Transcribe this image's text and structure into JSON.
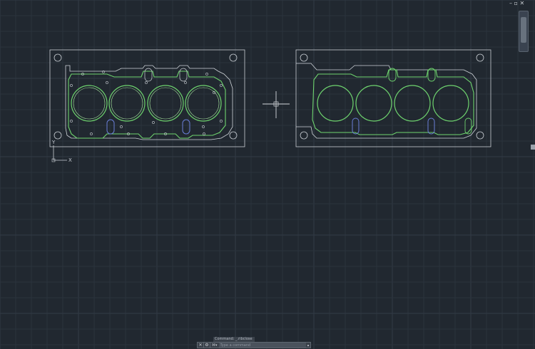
{
  "window_controls": [
    "–",
    "▫",
    "✕"
  ],
  "ucs": {
    "x_label": "X",
    "y_label": "Y"
  },
  "command_line": {
    "history": "Command: _.ribclose",
    "prompt": "⌘▾",
    "input_placeholder": "Type a command"
  },
  "colors": {
    "background": "#212830",
    "gasket_green": "#6ed36e",
    "outline_white": "#d7dbe0",
    "grid": "#323b46"
  }
}
